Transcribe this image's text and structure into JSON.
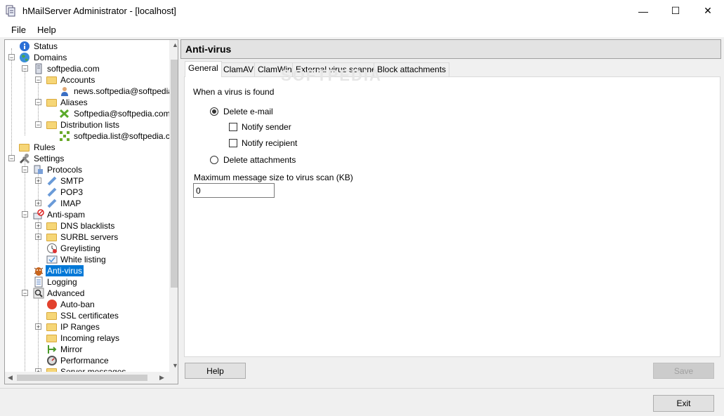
{
  "window": {
    "title": "hMailServer Administrator - [localhost]",
    "minimize": "—",
    "maximize": "☐",
    "close": "✕"
  },
  "menu": {
    "file": "File",
    "help": "Help"
  },
  "tree": {
    "status": "Status",
    "domains": "Domains",
    "domain": "softpedia.com",
    "accounts": "Accounts",
    "account_1": "news.softpedia@softpedia.c",
    "aliases": "Aliases",
    "alias_1": "Softpedia@softpedia.com",
    "distribution_lists": "Distribution lists",
    "list_1": "softpedia.list@softpedia.com",
    "rules": "Rules",
    "settings": "Settings",
    "protocols": "Protocols",
    "smtp": "SMTP",
    "pop3": "POP3",
    "imap": "IMAP",
    "antispam": "Anti-spam",
    "dns_blacklists": "DNS blacklists",
    "surbl": "SURBL servers",
    "greylisting": "Greylisting",
    "whitelisting": "White listing",
    "antivirus": "Anti-virus",
    "logging": "Logging",
    "advanced": "Advanced",
    "autoban": "Auto-ban",
    "ssl": "SSL certificates",
    "ip_ranges": "IP Ranges",
    "incoming_relays": "Incoming relays",
    "mirror": "Mirror",
    "performance": "Performance",
    "server_messages": "Server messages"
  },
  "pane": {
    "title": "Anti-virus",
    "tabs": [
      "General",
      "ClamAV",
      "ClamWin",
      "External virus scanner",
      "Block attachments"
    ],
    "when_virus_found": "When a virus is found",
    "delete_email": "Delete e-mail",
    "notify_sender": "Notify sender",
    "notify_recipient": "Notify recipient",
    "delete_attachments": "Delete attachments",
    "max_size_label": "Maximum message size to virus scan (KB)",
    "max_size_value": "0"
  },
  "buttons": {
    "help": "Help",
    "save": "Save",
    "exit": "Exit"
  },
  "watermark": "SOFTPEDIA"
}
